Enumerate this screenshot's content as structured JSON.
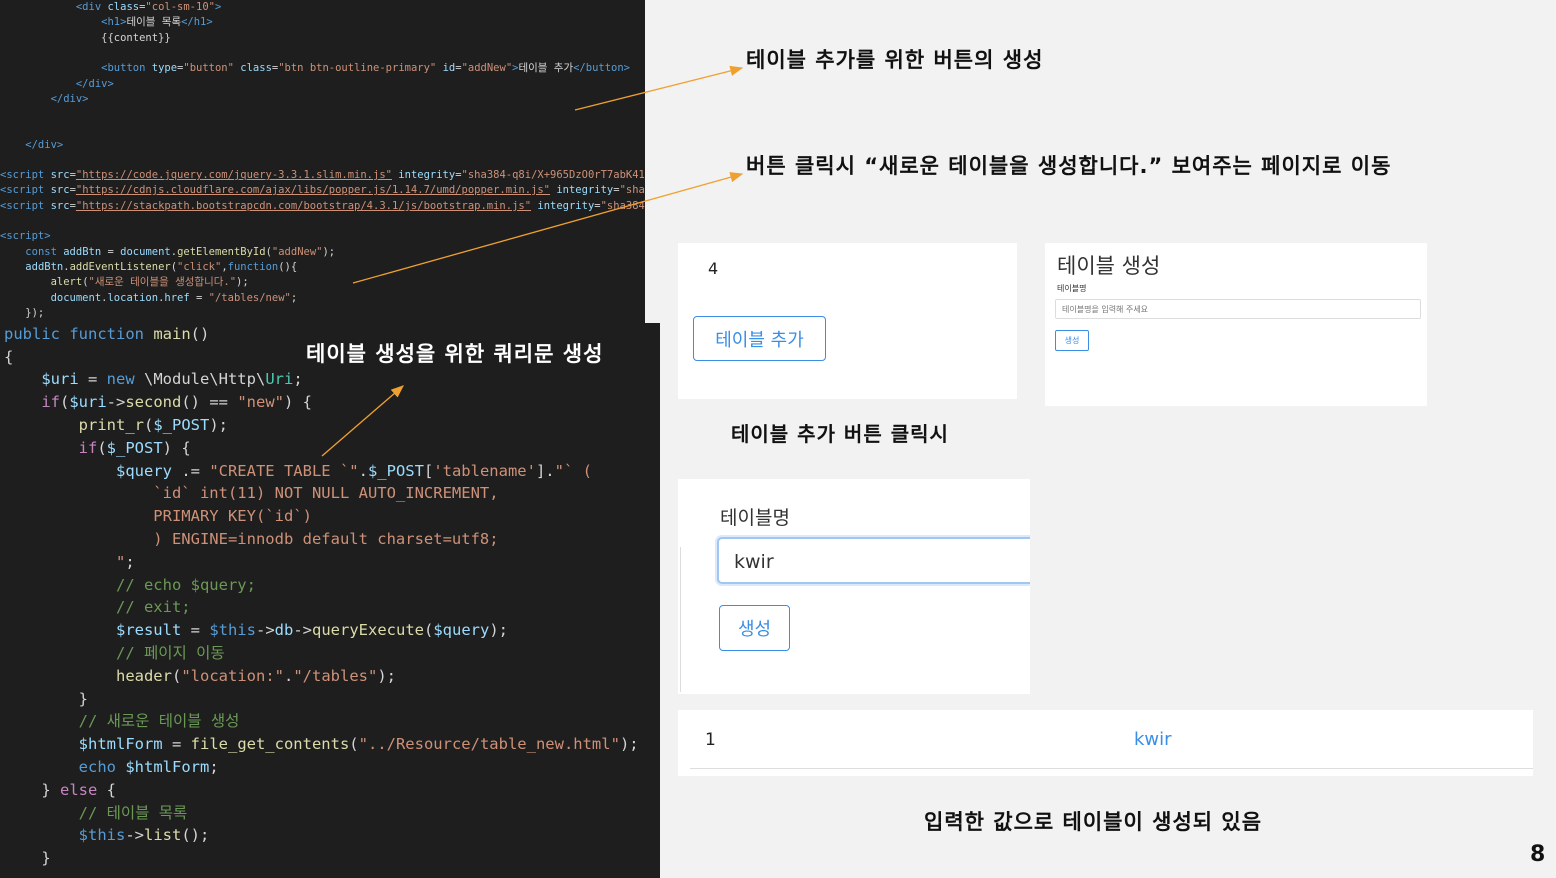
{
  "code_top": [
    "            <div class=\"col-sm-10\">",
    "                <h1>테이블 목록</h1>",
    "                {{content}}",
    "",
    "                <button type=\"button\" class=\"btn btn-outline-primary\" id=\"addNew\">테이블 추가</button>",
    "            </div>",
    "        </div>",
    "",
    "",
    "    </div>",
    "",
    "<script src=\"https://code.jquery.com/jquery-3.3.1.slim.min.js\" integrity=\"sha384-q8i/X+965DzO0rT7abK41",
    "<script src=\"https://cdnjs.cloudflare.com/ajax/libs/popper.js/1.14.7/umd/popper.min.js\" integrity=\"sha",
    "<script src=\"https://stackpath.bootstrapcdn.com/bootstrap/4.3.1/js/bootstrap.min.js\" integrity=\"sha384",
    "",
    "<script>",
    "    const addBtn = document.getElementById(\"addNew\");",
    "    addBtn.addEventListener(\"click\",function(){",
    "        alert(\"새로운 테이블을 생성합니다.\");",
    "        document.location.href = \"/tables/new\";",
    "    });"
  ],
  "code_bottom": [
    "public function main()",
    "{",
    "    $uri = new \\Module\\Http\\Uri;",
    "    if($uri->second() == \"new\") {",
    "        print_r($_POST);",
    "        if($_POST) {",
    "            $query .= \"CREATE TABLE `\".$_POST['tablename'].\"` (",
    "                `id` int(11) NOT NULL AUTO_INCREMENT,",
    "                PRIMARY KEY(`id`)",
    "                ) ENGINE=innodb default charset=utf8;",
    "            \";",
    "            // echo $query;",
    "            // exit;",
    "            $result = $this->db->queryExecute($query);",
    "            // 페이지 이동",
    "            header(\"location:\".\"/tables\");",
    "        }",
    "        // 새로운 테이블 생성",
    "        $htmlForm = file_get_contents(\"../Resource/table_new.html\");",
    "        echo $htmlForm;",
    "    } else {",
    "        // 테이블 목록",
    "        $this->list();",
    "    }"
  ],
  "annotations": {
    "button_create": "테이블 추가를 위한 버튼의 생성",
    "button_click": "버튼 클릭시 “새로운 테이블을 생성합니다.”  보여주는 페이지로 이동",
    "query": "테이블 생성을 위한 쿼리문 생성",
    "add_click": "테이블 추가 버튼 클릭시",
    "result": "입력한 값으로 테이블이 생성되 있음"
  },
  "panel_list": {
    "count": "4",
    "add_button": "테이블 추가"
  },
  "panel_form_small": {
    "title": "테이블 생성",
    "label": "테이블명",
    "placeholder": "테이블명을 입력해 주세요",
    "submit": "생성"
  },
  "panel_form_large": {
    "label": "테이블명",
    "value": "kwir",
    "submit": "생성"
  },
  "result_row": {
    "id": "1",
    "name": "kwir"
  },
  "page_number": "8",
  "colors": {
    "accent": "#3a8ee6",
    "arrow": "#f0a030",
    "editor_bg": "#1e1e1e"
  }
}
